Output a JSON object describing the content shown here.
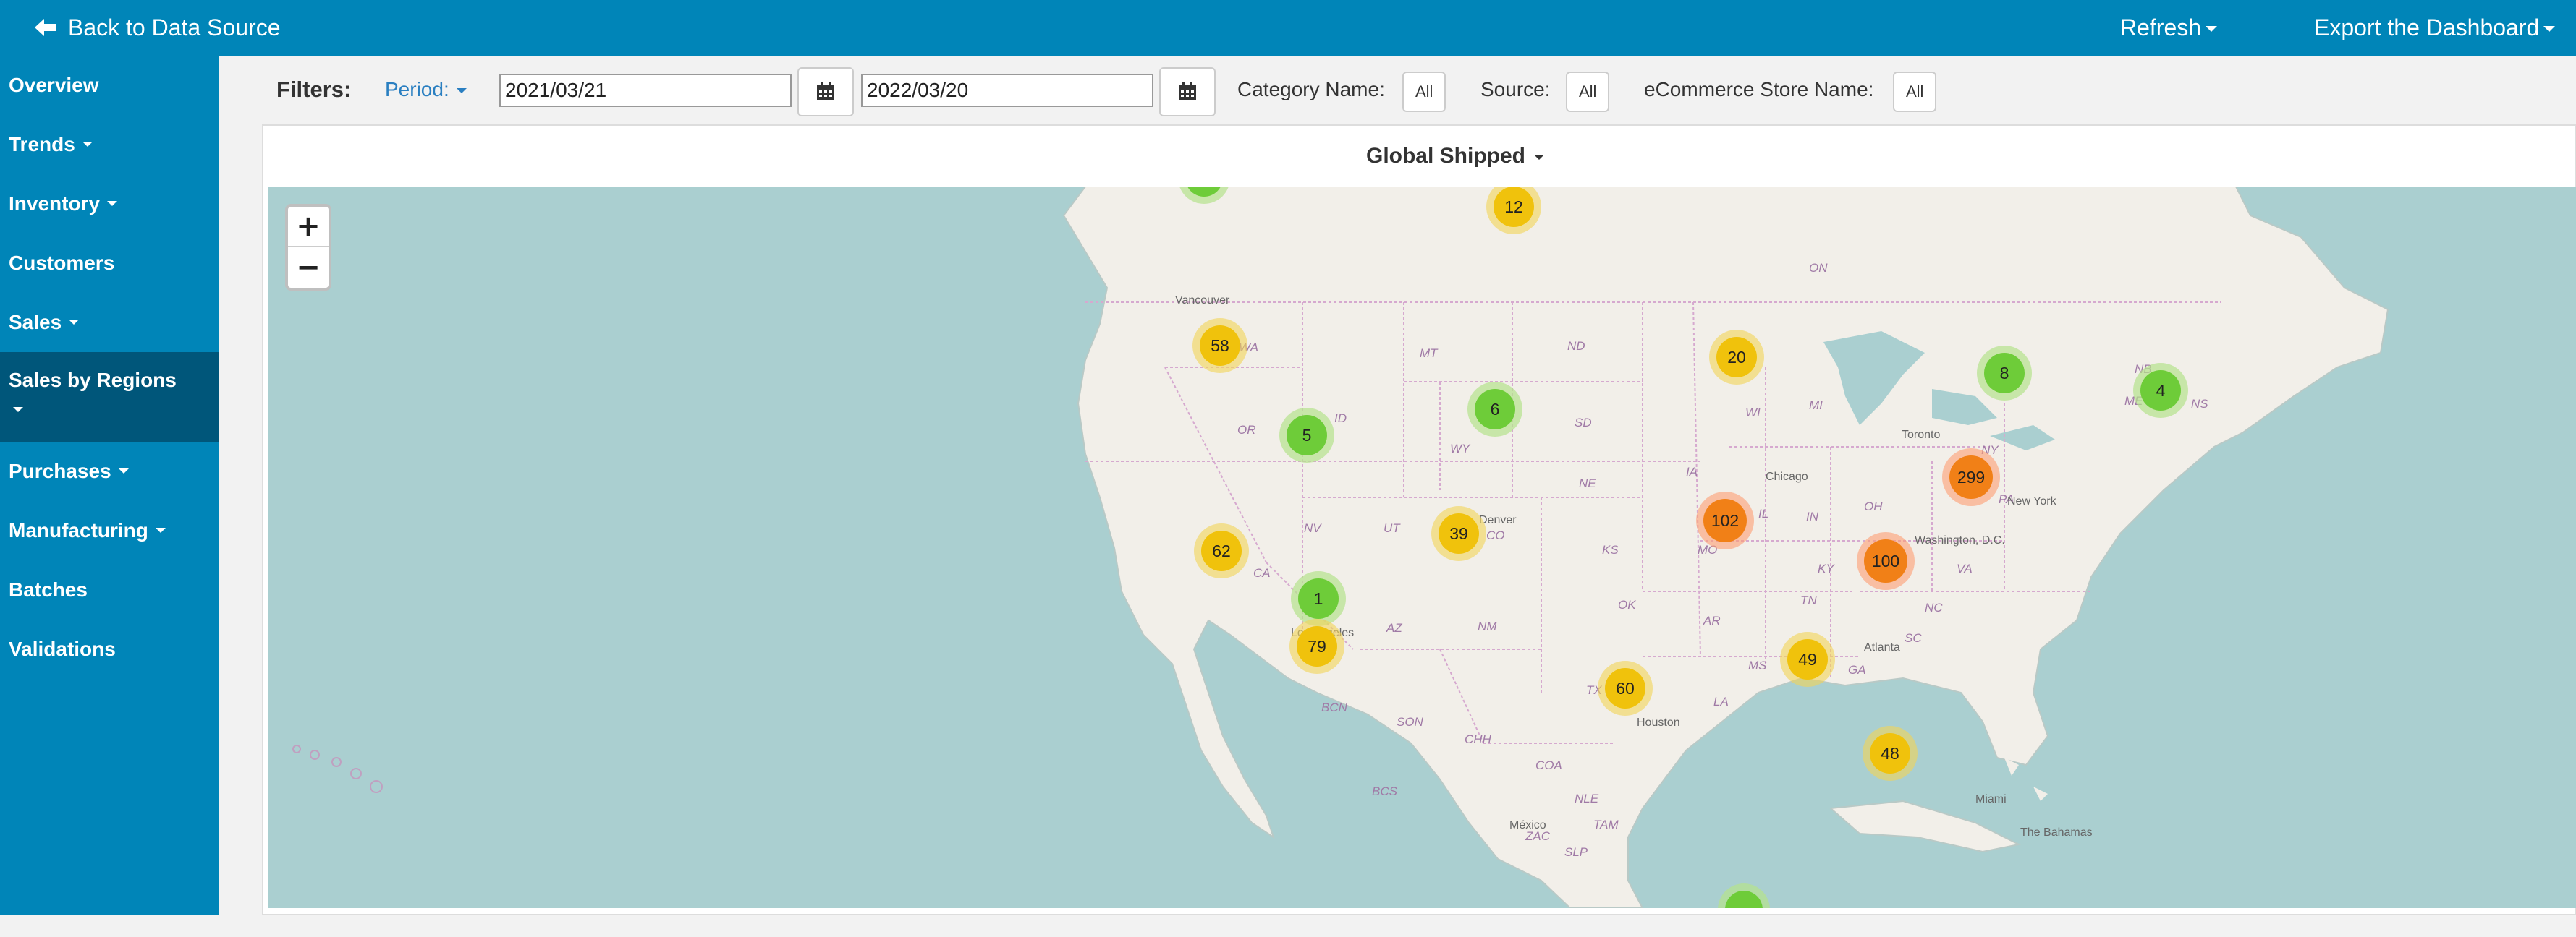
{
  "topbar": {
    "back_label": "Back to Data Source",
    "refresh_label": "Refresh",
    "export_label": "Export the Dashboard"
  },
  "sidebar": {
    "items": [
      {
        "label": "Overview",
        "caret": false
      },
      {
        "label": "Trends",
        "caret": true
      },
      {
        "label": "Inventory",
        "caret": true
      },
      {
        "label": "Customers",
        "caret": false
      },
      {
        "label": "Sales",
        "caret": true
      },
      {
        "label": "Sales by Regions",
        "caret": true,
        "active": true
      },
      {
        "label": "Purchases",
        "caret": true
      },
      {
        "label": "Manufacturing",
        "caret": true
      },
      {
        "label": "Batches",
        "caret": false
      },
      {
        "label": "Validations",
        "caret": false
      }
    ]
  },
  "filters": {
    "title": "Filters:",
    "period_label": "Period:",
    "start_date": "2021/03/21",
    "end_date": "2022/03/20",
    "category_label": "Category Name:",
    "category_value": "All",
    "source_label": "Source:",
    "source_value": "All",
    "store_label": "eCommerce Store Name:",
    "store_value": "All"
  },
  "panel": {
    "title": "Global Shipped"
  },
  "map": {
    "zoom_in": "+",
    "zoom_out": "−",
    "colors": {
      "water": "#aacfd0",
      "land": "#f2efe9",
      "border": "#d6a9cf",
      "cluster_green": "#6ecc39",
      "cluster_yellow": "#f0c20c",
      "cluster_orange": "#f18017"
    },
    "clusters": [
      {
        "count": "12",
        "level": "yellow"
      },
      {
        "count": "58",
        "level": "yellow"
      },
      {
        "count": "20",
        "level": "yellow"
      },
      {
        "count": "8",
        "level": "green"
      },
      {
        "count": "4",
        "level": "green"
      },
      {
        "count": "6",
        "level": "green"
      },
      {
        "count": "5",
        "level": "green"
      },
      {
        "count": "299",
        "level": "orange"
      },
      {
        "count": "102",
        "level": "orange"
      },
      {
        "count": "39",
        "level": "yellow"
      },
      {
        "count": "100",
        "level": "orange"
      },
      {
        "count": "62",
        "level": "yellow"
      },
      {
        "count": "1",
        "level": "green"
      },
      {
        "count": "79",
        "level": "yellow"
      },
      {
        "count": "49",
        "level": "yellow"
      },
      {
        "count": "60",
        "level": "yellow"
      },
      {
        "count": "48",
        "level": "yellow"
      }
    ],
    "region_labels": [
      "ON",
      "MT",
      "ND",
      "WY",
      "SD",
      "OR",
      "ID",
      "NV",
      "UT",
      "NE",
      "IA",
      "MI",
      "WI",
      "CA",
      "AZ",
      "NM",
      "OK",
      "KS",
      "MO",
      "IL",
      "IN",
      "OH",
      "KY",
      "TN",
      "AR",
      "MS",
      "GA",
      "SC",
      "NC",
      "VA",
      "PA",
      "NY",
      "ME",
      "NB",
      "NS",
      "TX",
      "LA",
      "CO",
      "WA",
      "BCN",
      "SON",
      "CHH",
      "COA",
      "NLE",
      "TAM",
      "SLP",
      "BCS",
      "ZAC"
    ],
    "city_labels": [
      "Vancouver",
      "Denver",
      "Chicago",
      "Toronto",
      "Washington, D.C.",
      "New York",
      "Atlanta",
      "Houston",
      "Los Angeles",
      "Miami",
      "México",
      "The Bahamas"
    ]
  }
}
